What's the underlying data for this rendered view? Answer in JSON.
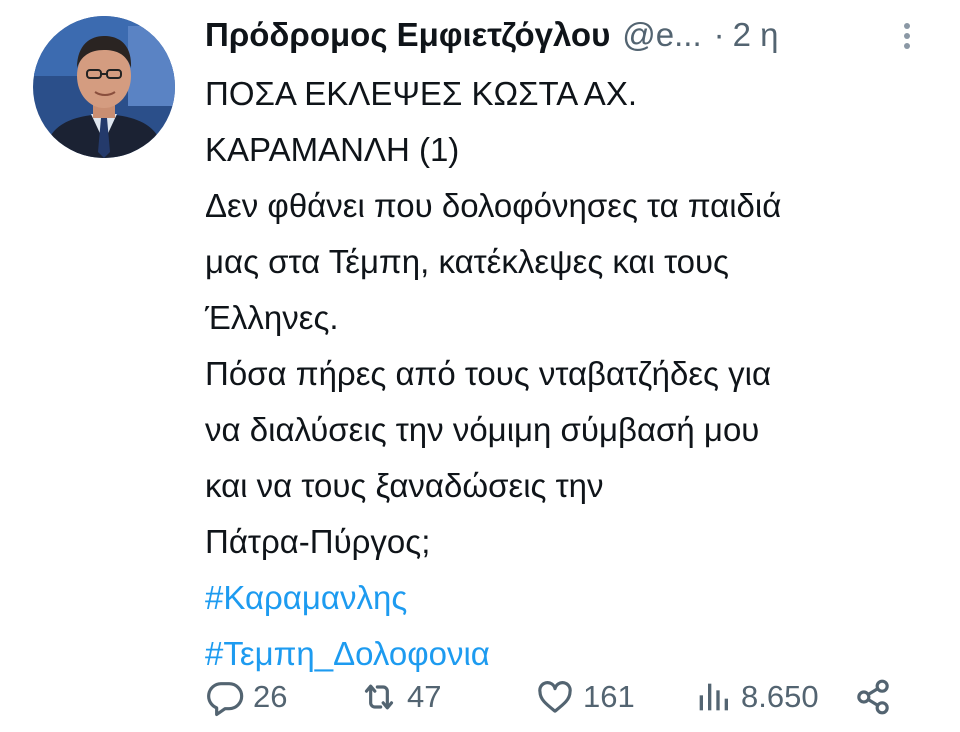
{
  "tweet": {
    "display_name": "Πρόδρομος Εμφιετζόγλου",
    "handle": "@e...",
    "separator": "·",
    "time": "2 η",
    "text_lines": [
      "ΠΟΣΑ ΕΚΛΕΨΕΣ ΚΩΣΤΑ ΑΧ.",
      "ΚΑΡΑΜΑΝΛΗ (1)",
      "Δεν φθάνει που δολοφόνησες τα παιδιά",
      "μας στα Τέμπη, κατέκλεψες και τους",
      "Έλληνες.",
      "Πόσα πήρες από τους νταβατζήδες για",
      "να διαλύσεις την νόμιμη σύμβασή μου",
      "και να τους ξαναδώσεις την",
      "Πάτρα-Πύργος;"
    ],
    "hashtags": [
      "#Καραμανλης",
      "#Τεμπη_Δολοφονια"
    ]
  },
  "actions": {
    "reply": {
      "icon": "reply-icon",
      "count": "26"
    },
    "retweet": {
      "icon": "retweet-icon",
      "count": "47"
    },
    "like": {
      "icon": "heart-icon",
      "count": "161"
    },
    "views": {
      "icon": "views-icon",
      "count": "8.650"
    },
    "share": {
      "icon": "share-icon"
    }
  },
  "colors": {
    "text": "#0f1419",
    "secondary": "#536471",
    "hashtag": "#1d9bf0"
  }
}
